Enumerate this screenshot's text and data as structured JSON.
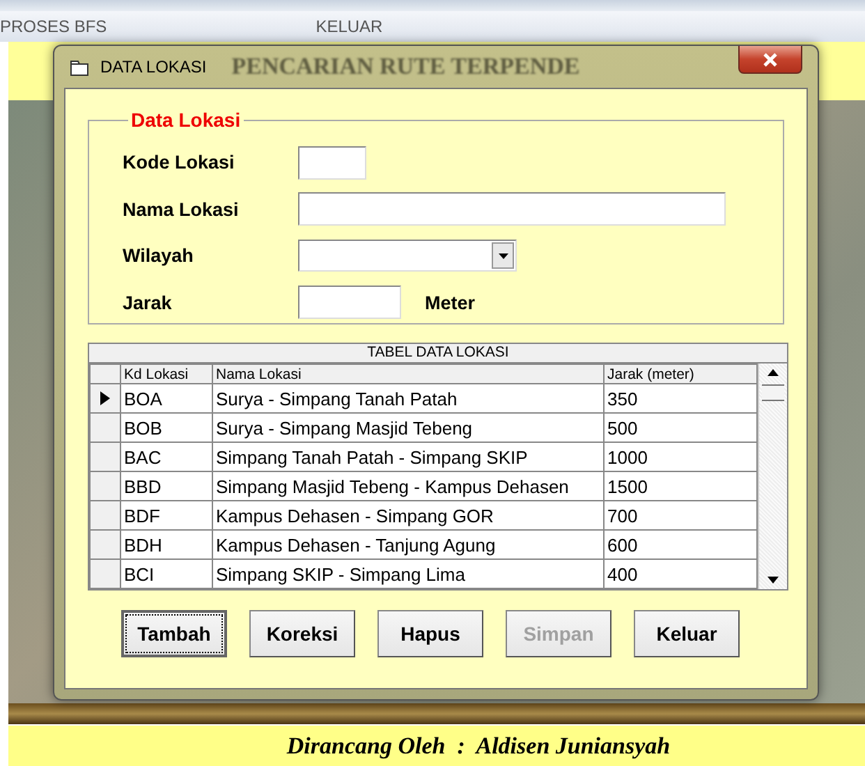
{
  "menu": [
    {
      "label": "PROSES BFS"
    },
    {
      "label": "KELUAR"
    }
  ],
  "background_title": "PENCARIAN RUTE TERPENDE",
  "dialog": {
    "title": "DATA LOKASI",
    "group": {
      "title": "Data Lokasi",
      "fields": [
        {
          "kind": "text",
          "label": "Kode Lokasi"
        },
        {
          "kind": "text",
          "label": "Nama Lokasi"
        },
        {
          "kind": "combo",
          "label": "Wilayah"
        },
        {
          "kind": "text",
          "label": "Jarak",
          "unit": "Meter"
        }
      ]
    },
    "table": {
      "caption": "TABEL DATA LOKASI",
      "columns": [
        "Kd Lokasi",
        "Nama Lokasi",
        "Jarak (meter)"
      ],
      "rows": [
        {
          "selected": true,
          "cells": [
            "BOA",
            "Surya - Simpang Tanah Patah",
            "350"
          ]
        },
        {
          "selected": false,
          "cells": [
            "BOB",
            "Surya - Simpang Masjid Tebeng",
            "500"
          ]
        },
        {
          "selected": false,
          "cells": [
            "BAC",
            "Simpang Tanah Patah - Simpang SKIP",
            "1000"
          ]
        },
        {
          "selected": false,
          "cells": [
            "BBD",
            "Simpang Masjid Tebeng - Kampus Dehasen",
            "1500"
          ]
        },
        {
          "selected": false,
          "cells": [
            "BDF",
            "Kampus Dehasen - Simpang GOR",
            "700"
          ]
        },
        {
          "selected": false,
          "cells": [
            "BDH",
            "Kampus Dehasen - Tanjung Agung",
            "600"
          ]
        },
        {
          "selected": false,
          "cells": [
            "BCI",
            "Simpang SKIP - Simpang Lima",
            "400"
          ]
        }
      ]
    },
    "buttons": [
      {
        "label": "Tambah",
        "disabled": false,
        "focused": true
      },
      {
        "label": "Koreksi",
        "disabled": false,
        "focused": false
      },
      {
        "label": "Hapus",
        "disabled": false,
        "focused": false
      },
      {
        "label": "Simpan",
        "disabled": true,
        "focused": false
      },
      {
        "label": "Keluar",
        "disabled": false,
        "focused": false
      }
    ]
  },
  "footer": "Dirancang Oleh  :  Aldisen Juniansyah"
}
